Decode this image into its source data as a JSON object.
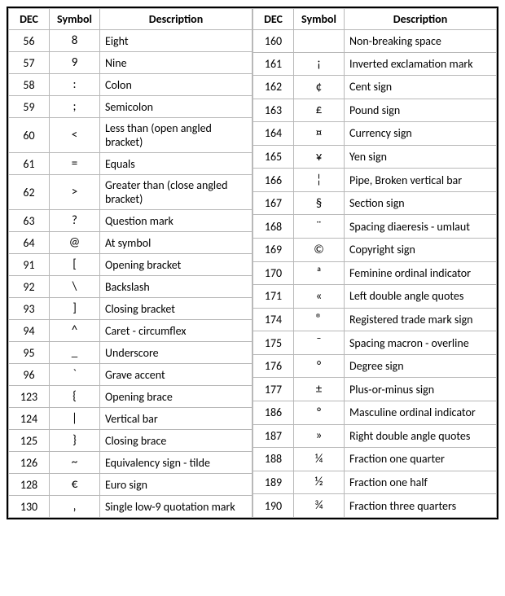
{
  "headers": {
    "dec": "DEC",
    "symbol": "Symbol",
    "description": "Description"
  },
  "left": [
    {
      "dec": "56",
      "symbol": "8",
      "description": "Eight"
    },
    {
      "dec": "57",
      "symbol": "9",
      "description": "Nine"
    },
    {
      "dec": "58",
      "symbol": ":",
      "description": "Colon"
    },
    {
      "dec": "59",
      "symbol": ";",
      "description": "Semicolon"
    },
    {
      "dec": "60",
      "symbol": "<",
      "description": "Less than (open angled bracket)"
    },
    {
      "dec": "61",
      "symbol": "=",
      "description": "Equals"
    },
    {
      "dec": "62",
      "symbol": ">",
      "description": "Greater than (close angled bracket)"
    },
    {
      "dec": "63",
      "symbol": "?",
      "description": "Question mark"
    },
    {
      "dec": "64",
      "symbol": "@",
      "description": "At symbol"
    },
    {
      "dec": "91",
      "symbol": "[",
      "description": "Opening bracket"
    },
    {
      "dec": "92",
      "symbol": "\\",
      "description": "Backslash"
    },
    {
      "dec": "93",
      "symbol": "]",
      "description": "Closing bracket"
    },
    {
      "dec": "94",
      "symbol": "^",
      "description": "Caret - circumflex"
    },
    {
      "dec": "95",
      "symbol": "_",
      "description": "Underscore"
    },
    {
      "dec": "96",
      "symbol": "`",
      "description": "Grave accent"
    },
    {
      "dec": "123",
      "symbol": "{",
      "description": "Opening brace"
    },
    {
      "dec": "124",
      "symbol": "|",
      "description": "Vertical bar"
    },
    {
      "dec": "125",
      "symbol": "}",
      "description": "Closing brace"
    },
    {
      "dec": "126",
      "symbol": "~",
      "description": "Equivalency sign - tilde"
    },
    {
      "dec": "128",
      "symbol": "€",
      "description": "Euro sign"
    },
    {
      "dec": "130",
      "symbol": "‚",
      "description": "Single low-9 quotation mark"
    }
  ],
  "right": [
    {
      "dec": "160",
      "symbol": "",
      "description": "Non-breaking space"
    },
    {
      "dec": "161",
      "symbol": "¡",
      "description": "Inverted exclamation mark"
    },
    {
      "dec": "162",
      "symbol": "¢",
      "description": "Cent sign"
    },
    {
      "dec": "163",
      "symbol": "£",
      "description": "Pound sign"
    },
    {
      "dec": "164",
      "symbol": "¤",
      "description": "Currency sign"
    },
    {
      "dec": "165",
      "symbol": "¥",
      "description": "Yen sign"
    },
    {
      "dec": "166",
      "symbol": "¦",
      "description": "Pipe, Broken vertical bar"
    },
    {
      "dec": "167",
      "symbol": "§",
      "description": "Section sign"
    },
    {
      "dec": "168",
      "symbol": "¨",
      "description": "Spacing diaeresis - umlaut"
    },
    {
      "dec": "169",
      "symbol": "©",
      "description": "Copyright sign"
    },
    {
      "dec": "170",
      "symbol": "ª",
      "description": "Feminine ordinal indicator"
    },
    {
      "dec": "171",
      "symbol": "«",
      "description": "Left double angle quotes"
    },
    {
      "dec": "174",
      "symbol": "®",
      "description": "Registered trade mark sign"
    },
    {
      "dec": "175",
      "symbol": "¯",
      "description": "Spacing macron - overline"
    },
    {
      "dec": "176",
      "symbol": "°",
      "description": "Degree sign"
    },
    {
      "dec": "177",
      "symbol": "±",
      "description": "Plus-or-minus sign"
    },
    {
      "dec": "186",
      "symbol": "º",
      "description": "Masculine ordinal indicator"
    },
    {
      "dec": "187",
      "symbol": "»",
      "description": "Right double angle quotes"
    },
    {
      "dec": "188",
      "symbol": "¼",
      "description": "Fraction one quarter"
    },
    {
      "dec": "189",
      "symbol": "½",
      "description": "Fraction one half"
    },
    {
      "dec": "190",
      "symbol": "¾",
      "description": "Fraction three quarters"
    }
  ]
}
